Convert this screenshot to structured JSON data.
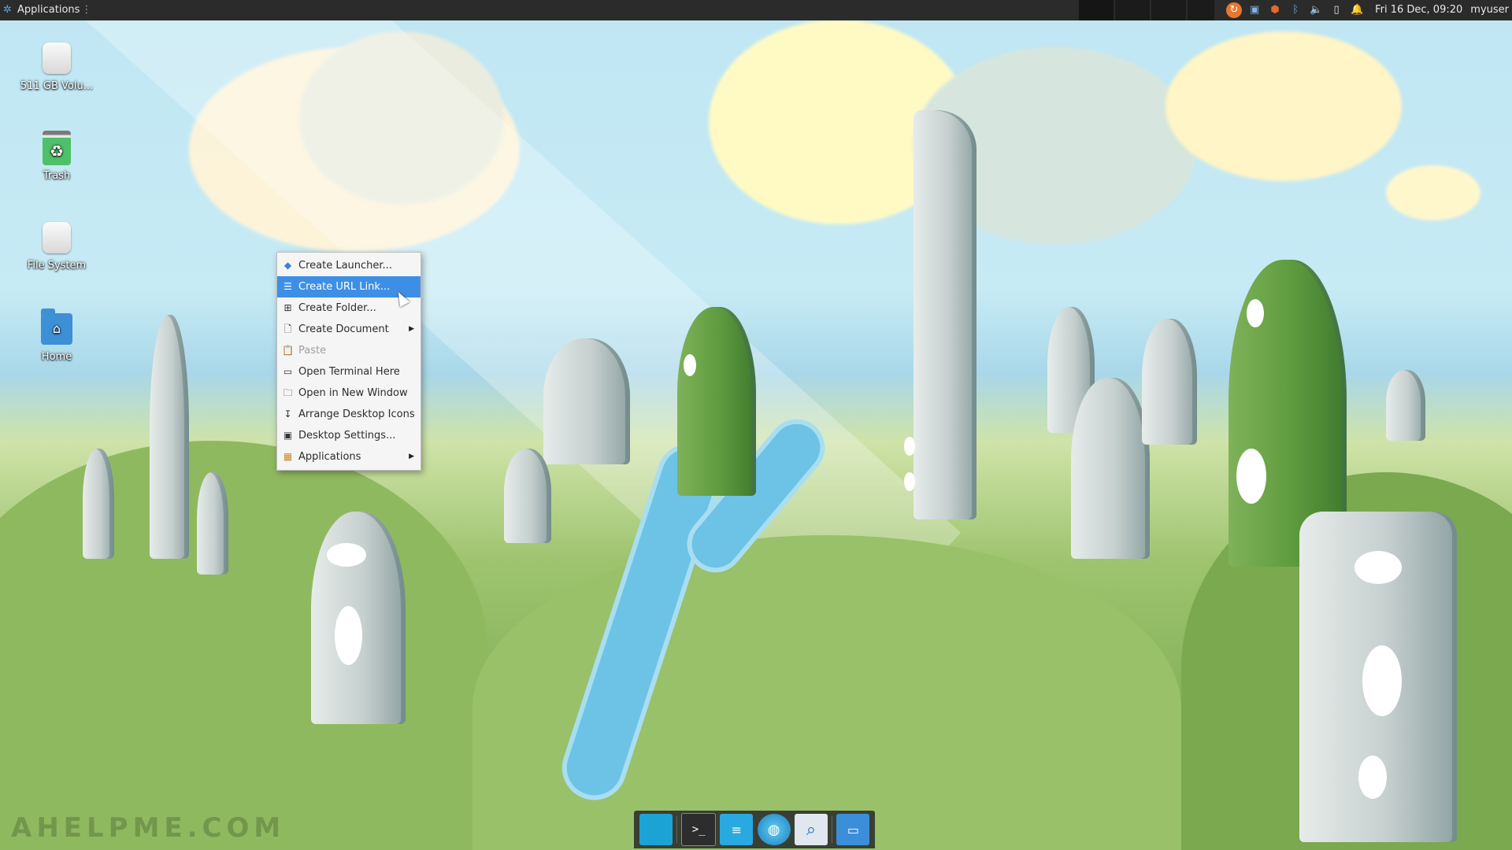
{
  "top_panel": {
    "apps_label": "Applications",
    "apps_icon": "xfce-mouse-icon",
    "tray_icons": [
      "update-notifier-icon",
      "network-icon",
      "package-icon",
      "bluetooth-icon",
      "volume-icon",
      "battery-icon",
      "notification-bell-icon"
    ],
    "clock": "Fri 16 Dec, 09:20",
    "user": "myuser"
  },
  "desktop_icons": [
    {
      "label": "511 GB Volu...",
      "icon": "drive-icon"
    },
    {
      "label": "Trash",
      "icon": "trash-icon"
    },
    {
      "label": "File System",
      "icon": "filesystem-drive-icon"
    },
    {
      "label": "Home",
      "icon": "home-folder-icon"
    }
  ],
  "context_menu": {
    "items": [
      {
        "label": "Create Launcher...",
        "icon": "launcher-icon"
      },
      {
        "label": "Create URL Link...",
        "icon": "url-link-icon",
        "state": "selected"
      },
      {
        "label": "Create Folder...",
        "icon": "new-folder-icon"
      },
      {
        "label": "Create Document",
        "icon": "new-document-icon",
        "submenu": true
      },
      {
        "label": "Paste",
        "icon": "paste-icon",
        "state": "disabled"
      },
      {
        "label": "Open Terminal Here",
        "icon": "terminal-icon"
      },
      {
        "label": "Open in New Window",
        "icon": "open-folder-icon"
      },
      {
        "label": "Arrange Desktop Icons",
        "icon": "arrange-icon"
      },
      {
        "label": "Desktop Settings...",
        "icon": "desktop-settings-icon"
      },
      {
        "label": "Applications",
        "icon": "applications-icon",
        "submenu": true
      }
    ]
  },
  "dock": {
    "items": [
      "show-desktop-icon",
      "terminal-icon",
      "text-editor-icon",
      "web-browser-icon",
      "search-icon",
      "file-manager-icon"
    ]
  },
  "watermark": "AHELPME.COM",
  "colors": {
    "panel_bg": "#2b2b2b",
    "menu_selected": "#3d8fe6",
    "menu_bg": "#f5f5f5"
  }
}
